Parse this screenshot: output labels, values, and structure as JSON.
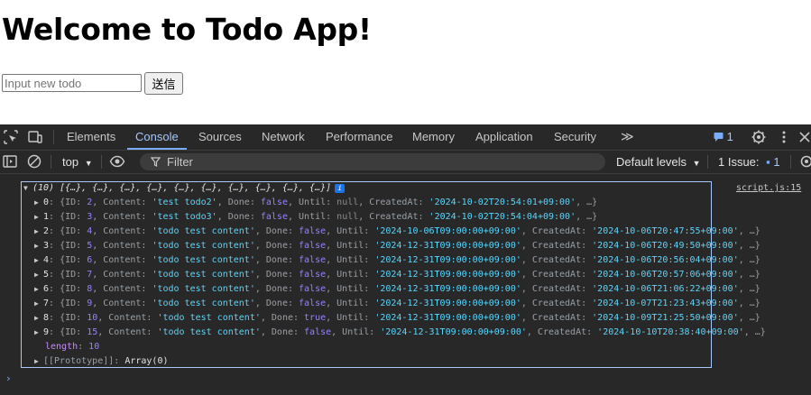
{
  "page": {
    "heading": "Welcome to Todo App!",
    "input_placeholder": "Input new todo",
    "input_value": "",
    "submit_label": "送信"
  },
  "devtools": {
    "tabs": [
      "Elements",
      "Console",
      "Sources",
      "Network",
      "Performance",
      "Memory",
      "Application",
      "Security"
    ],
    "active_tab": "Console",
    "more_tabs": "≫",
    "message_count": "1",
    "toolbar": {
      "context": "top",
      "filter_placeholder": "Filter",
      "levels": "Default levels",
      "issues_label": "1 Issue:",
      "issues_count": "1"
    },
    "console": {
      "source_link": "script.js:15",
      "array_summary": "(10) [{…}, {…}, {…}, {…}, {…}, {…}, {…}, {…}, {…}, {…}]",
      "length_key": "length",
      "length_value": "10",
      "prototype_key": "[[Prototype]]",
      "prototype_value": "Array(0)",
      "items": [
        {
          "index": "0",
          "id": "2",
          "content": "'test todo2'",
          "done": "false",
          "until": "null",
          "created": "'2024-10-02T20:54:01+09:00'"
        },
        {
          "index": "1",
          "id": "3",
          "content": "'test todo3'",
          "done": "false",
          "until": "null",
          "created": "'2024-10-02T20:54:04+09:00'"
        },
        {
          "index": "2",
          "id": "4",
          "content": "'todo test content'",
          "done": "false",
          "until": "'2024-10-06T09:00:00+09:00'",
          "created": "'2024-10-06T20:47:55+09:00'"
        },
        {
          "index": "3",
          "id": "5",
          "content": "'todo test content'",
          "done": "false",
          "until": "'2024-12-31T09:00:00+09:00'",
          "created": "'2024-10-06T20:49:50+09:00'"
        },
        {
          "index": "4",
          "id": "6",
          "content": "'todo test content'",
          "done": "false",
          "until": "'2024-12-31T09:00:00+09:00'",
          "created": "'2024-10-06T20:56:04+09:00'"
        },
        {
          "index": "5",
          "id": "7",
          "content": "'todo test content'",
          "done": "false",
          "until": "'2024-12-31T09:00:00+09:00'",
          "created": "'2024-10-06T20:57:06+09:00'"
        },
        {
          "index": "6",
          "id": "8",
          "content": "'todo test content'",
          "done": "false",
          "until": "'2024-12-31T09:00:00+09:00'",
          "created": "'2024-10-06T21:06:22+09:00'"
        },
        {
          "index": "7",
          "id": "9",
          "content": "'todo test content'",
          "done": "false",
          "until": "'2024-12-31T09:00:00+09:00'",
          "created": "'2024-10-07T21:23:43+09:00'"
        },
        {
          "index": "8",
          "id": "10",
          "content": "'todo test content'",
          "done": "true",
          "until": "'2024-12-31T09:00:00+09:00'",
          "created": "'2024-10-09T21:25:50+09:00'"
        },
        {
          "index": "9",
          "id": "15",
          "content": "'todo test content'",
          "done": "false",
          "until": "'2024-12-31T09:00:00+09:00'",
          "created": "'2024-10-10T20:38:40+09:00'"
        }
      ]
    }
  },
  "colors": {
    "devtools_bg": "#282828",
    "active_tab": "#a8c7fa",
    "string": "#5cd5fb",
    "keyword": "#9980ff"
  }
}
